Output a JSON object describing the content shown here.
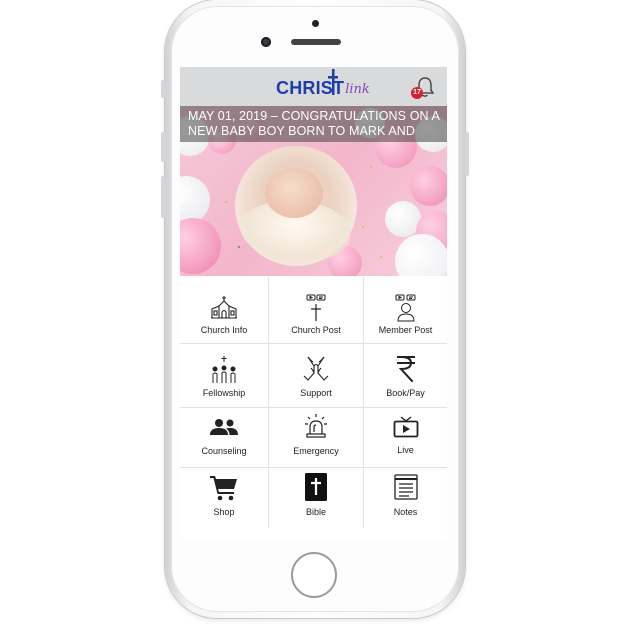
{
  "app": {
    "logo_text": "CHRIST",
    "logo_script": "link",
    "notification_count": "17",
    "brand_color": "#1d3fa8",
    "accent_color": "#8a45b8",
    "badge_color": "#d42030"
  },
  "banner": {
    "caption": "MAY 01, 2019 – CONGRATULATIONS ON A NEW BABY BOY BORN TO MARK AND"
  },
  "menu": {
    "items": [
      {
        "label": "Church Info",
        "icon": "church-icon"
      },
      {
        "label": "Church Post",
        "icon": "cross-post-icon"
      },
      {
        "label": "Member Post",
        "icon": "member-post-icon"
      },
      {
        "label": "Fellowship",
        "icon": "fellowship-icon"
      },
      {
        "label": "Support",
        "icon": "praying-hands-icon"
      },
      {
        "label": "Book/Pay",
        "icon": "rupee-icon"
      },
      {
        "label": "Counseling",
        "icon": "people-icon"
      },
      {
        "label": "Emergency",
        "icon": "siren-icon"
      },
      {
        "label": "Live",
        "icon": "tv-play-icon"
      },
      {
        "label": "Shop",
        "icon": "cart-icon"
      },
      {
        "label": "Bible",
        "icon": "bible-icon"
      },
      {
        "label": "Notes",
        "icon": "notes-icon"
      }
    ]
  }
}
